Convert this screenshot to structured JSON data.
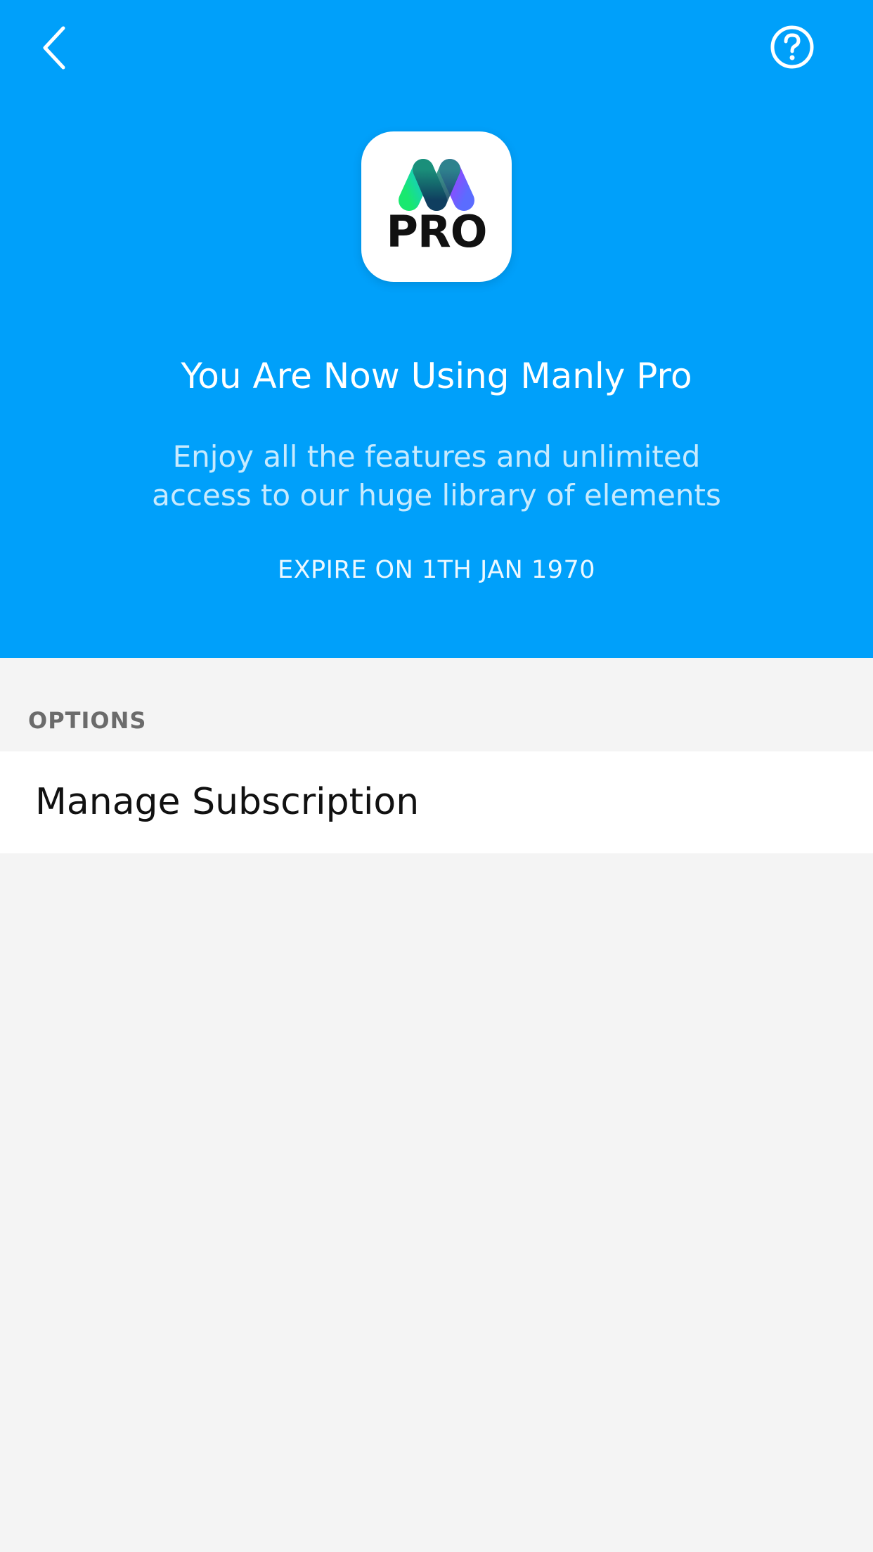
{
  "nav": {
    "back_icon": "chevron-left-icon",
    "help_icon": "question-circle-icon"
  },
  "app_icon": {
    "logo_icon": "manly-m-logo-icon",
    "text": "PRO"
  },
  "hero": {
    "title": "You Are Now Using Manly Pro",
    "subtitle": "Enjoy all the features and unlimited access to our huge library of elements",
    "expire": "EXPIRE ON 1TH JAN 1970"
  },
  "options": {
    "section_label": "OPTIONS",
    "items": [
      {
        "label": "Manage Subscription"
      }
    ]
  },
  "colors": {
    "header_bg": "#00a0fa",
    "page_bg": "#f4f4f4",
    "row_bg": "#ffffff"
  }
}
